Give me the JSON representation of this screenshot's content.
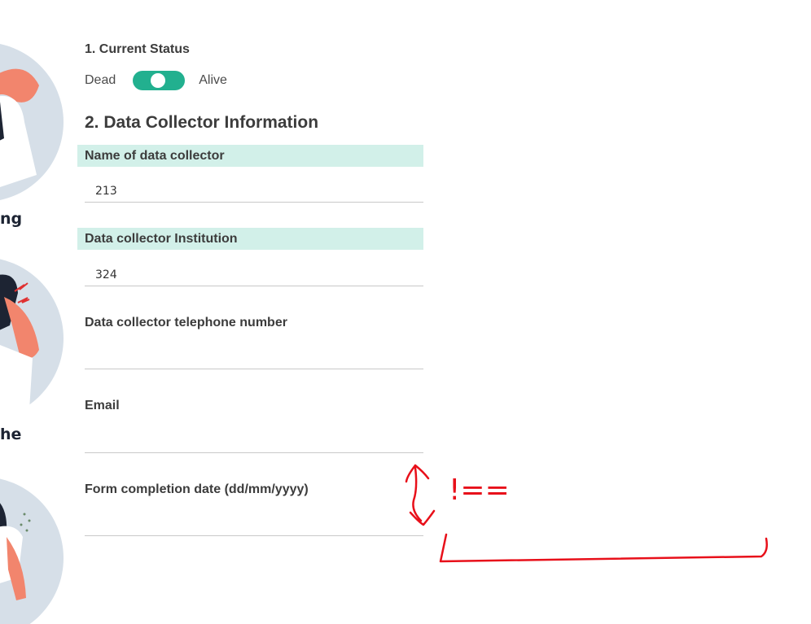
{
  "sidebar": {
    "captions": [
      "ng",
      "he"
    ]
  },
  "status": {
    "title": "1. Current Status",
    "left_label": "Dead",
    "right_label": "Alive",
    "state": "Alive",
    "toggle_color": "#22b08f"
  },
  "collector": {
    "title": "2. Data Collector Information",
    "fields": [
      {
        "label": "Name of data collector",
        "value": "213"
      },
      {
        "label": "Data collector Institution",
        "value": "324"
      },
      {
        "label": "Data collector telephone number",
        "value": ""
      },
      {
        "label": "Email",
        "value": ""
      },
      {
        "label": "Form completion date (dd/mm/yyyy)",
        "value": ""
      }
    ],
    "highlight_color": "#d2f0e9"
  },
  "annotation": {
    "color": "#e8101a",
    "text": "!=="
  }
}
